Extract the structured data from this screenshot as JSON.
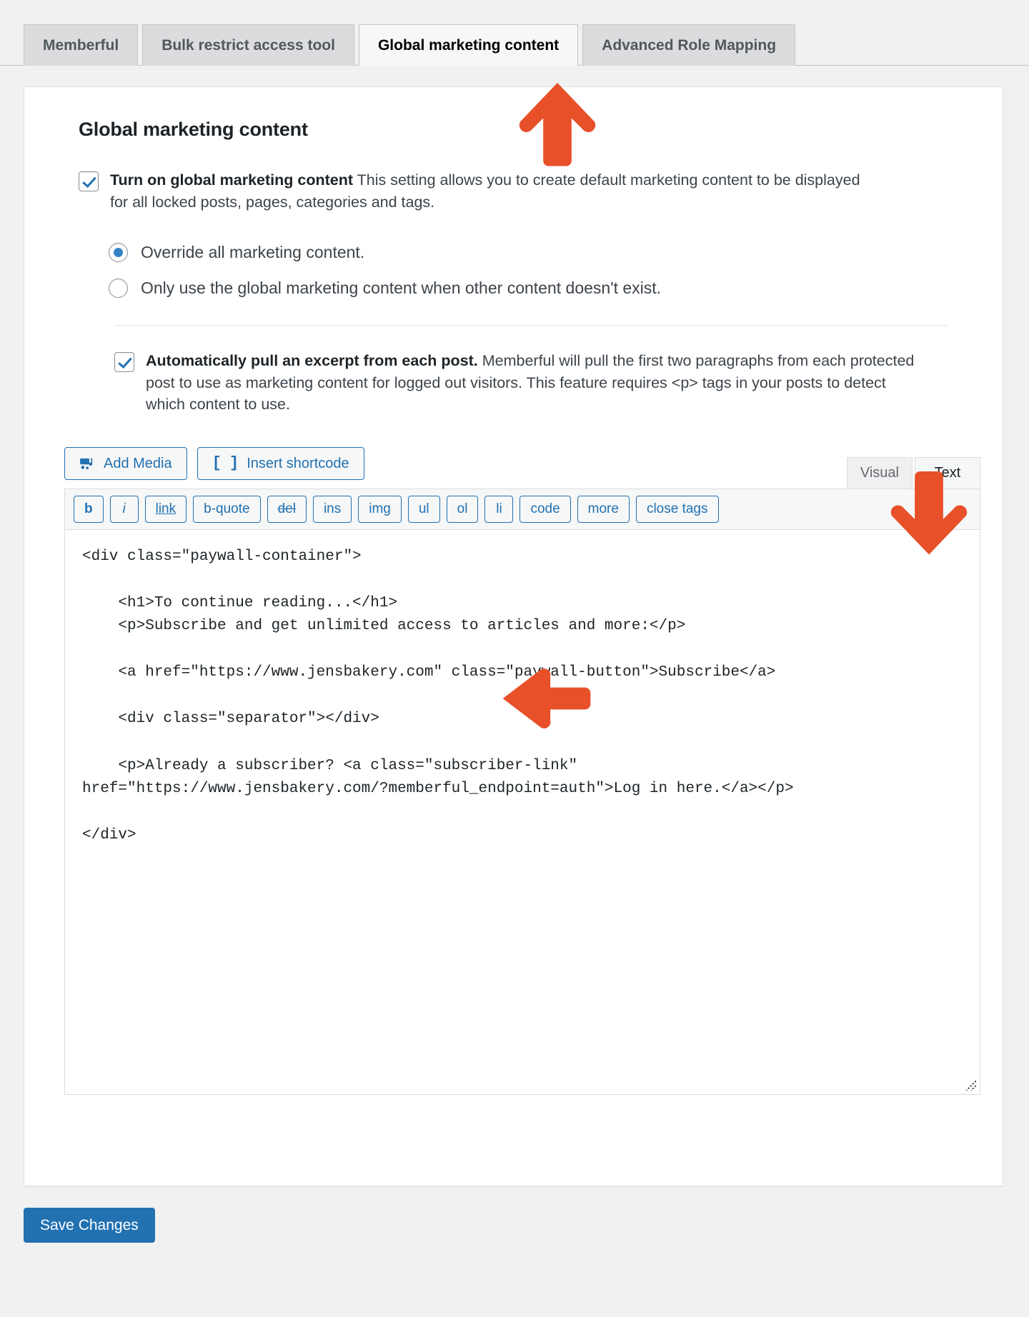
{
  "tabs": [
    {
      "label": "Memberful",
      "active": false
    },
    {
      "label": "Bulk restrict access tool",
      "active": false
    },
    {
      "label": "Global marketing content",
      "active": true
    },
    {
      "label": "Advanced Role Mapping",
      "active": false
    }
  ],
  "panel": {
    "title": "Global marketing content",
    "enable_setting": {
      "checked": true,
      "strong": "Turn on global marketing content",
      "rest": " This setting allows you to create default marketing content to be displayed for all locked posts, pages, categories and tags."
    },
    "radios": [
      {
        "label": "Override all marketing content.",
        "selected": true
      },
      {
        "label": "Only use the global marketing content when other content doesn't exist.",
        "selected": false
      }
    ],
    "excerpt_setting": {
      "checked": true,
      "strong": "Automatically pull an excerpt from each post.",
      "rest": " Memberful will pull the first two paragraphs from each protected post to use as marketing content for logged out visitors. This feature requires <p> tags in your posts to detect which content to use."
    }
  },
  "editor": {
    "add_media_label": "Add Media",
    "insert_shortcode_label": "Insert shortcode",
    "shortcode_glyph": "[ ]",
    "mode_tabs": [
      {
        "label": "Visual",
        "active": false
      },
      {
        "label": "Text",
        "active": true
      }
    ],
    "quicktags": [
      {
        "label": "b",
        "style": "b"
      },
      {
        "label": "i",
        "style": "i"
      },
      {
        "label": "link",
        "style": "link"
      },
      {
        "label": "b-quote",
        "style": ""
      },
      {
        "label": "del",
        "style": "del"
      },
      {
        "label": "ins",
        "style": ""
      },
      {
        "label": "img",
        "style": ""
      },
      {
        "label": "ul",
        "style": ""
      },
      {
        "label": "ol",
        "style": ""
      },
      {
        "label": "li",
        "style": ""
      },
      {
        "label": "code",
        "style": ""
      },
      {
        "label": "more",
        "style": ""
      },
      {
        "label": "close tags",
        "style": ""
      }
    ],
    "content": "<div class=\"paywall-container\">\n\n    <h1>To continue reading...</h1>\n    <p>Subscribe and get unlimited access to articles and more:</p>\n\n    <a href=\"https://www.jensbakery.com\" class=\"paywall-button\">Subscribe</a>\n\n    <div class=\"separator\"></div>\n\n    <p>Already a subscriber? <a class=\"subscriber-link\"\nhref=\"https://www.jensbakery.com/?memberful_endpoint=auth\">Log in here.</a></p>\n\n</div>"
  },
  "footer": {
    "save_label": "Save Changes"
  },
  "annotations": {
    "arrow_color": "#E8502A",
    "arrows": [
      {
        "name": "arrow-to-global-marketing-content-tab",
        "direction": "up"
      },
      {
        "name": "arrow-to-text-mode-tab",
        "direction": "down"
      },
      {
        "name": "arrow-to-code-editor",
        "direction": "left"
      }
    ]
  },
  "colors": {
    "page_background": "#f1f1f1",
    "panel_background": "#ffffff",
    "primary_button": "#2271b1",
    "accent_link": "#2271b1",
    "radio_dot": "#3582c4",
    "arrow": "#E8502A"
  }
}
